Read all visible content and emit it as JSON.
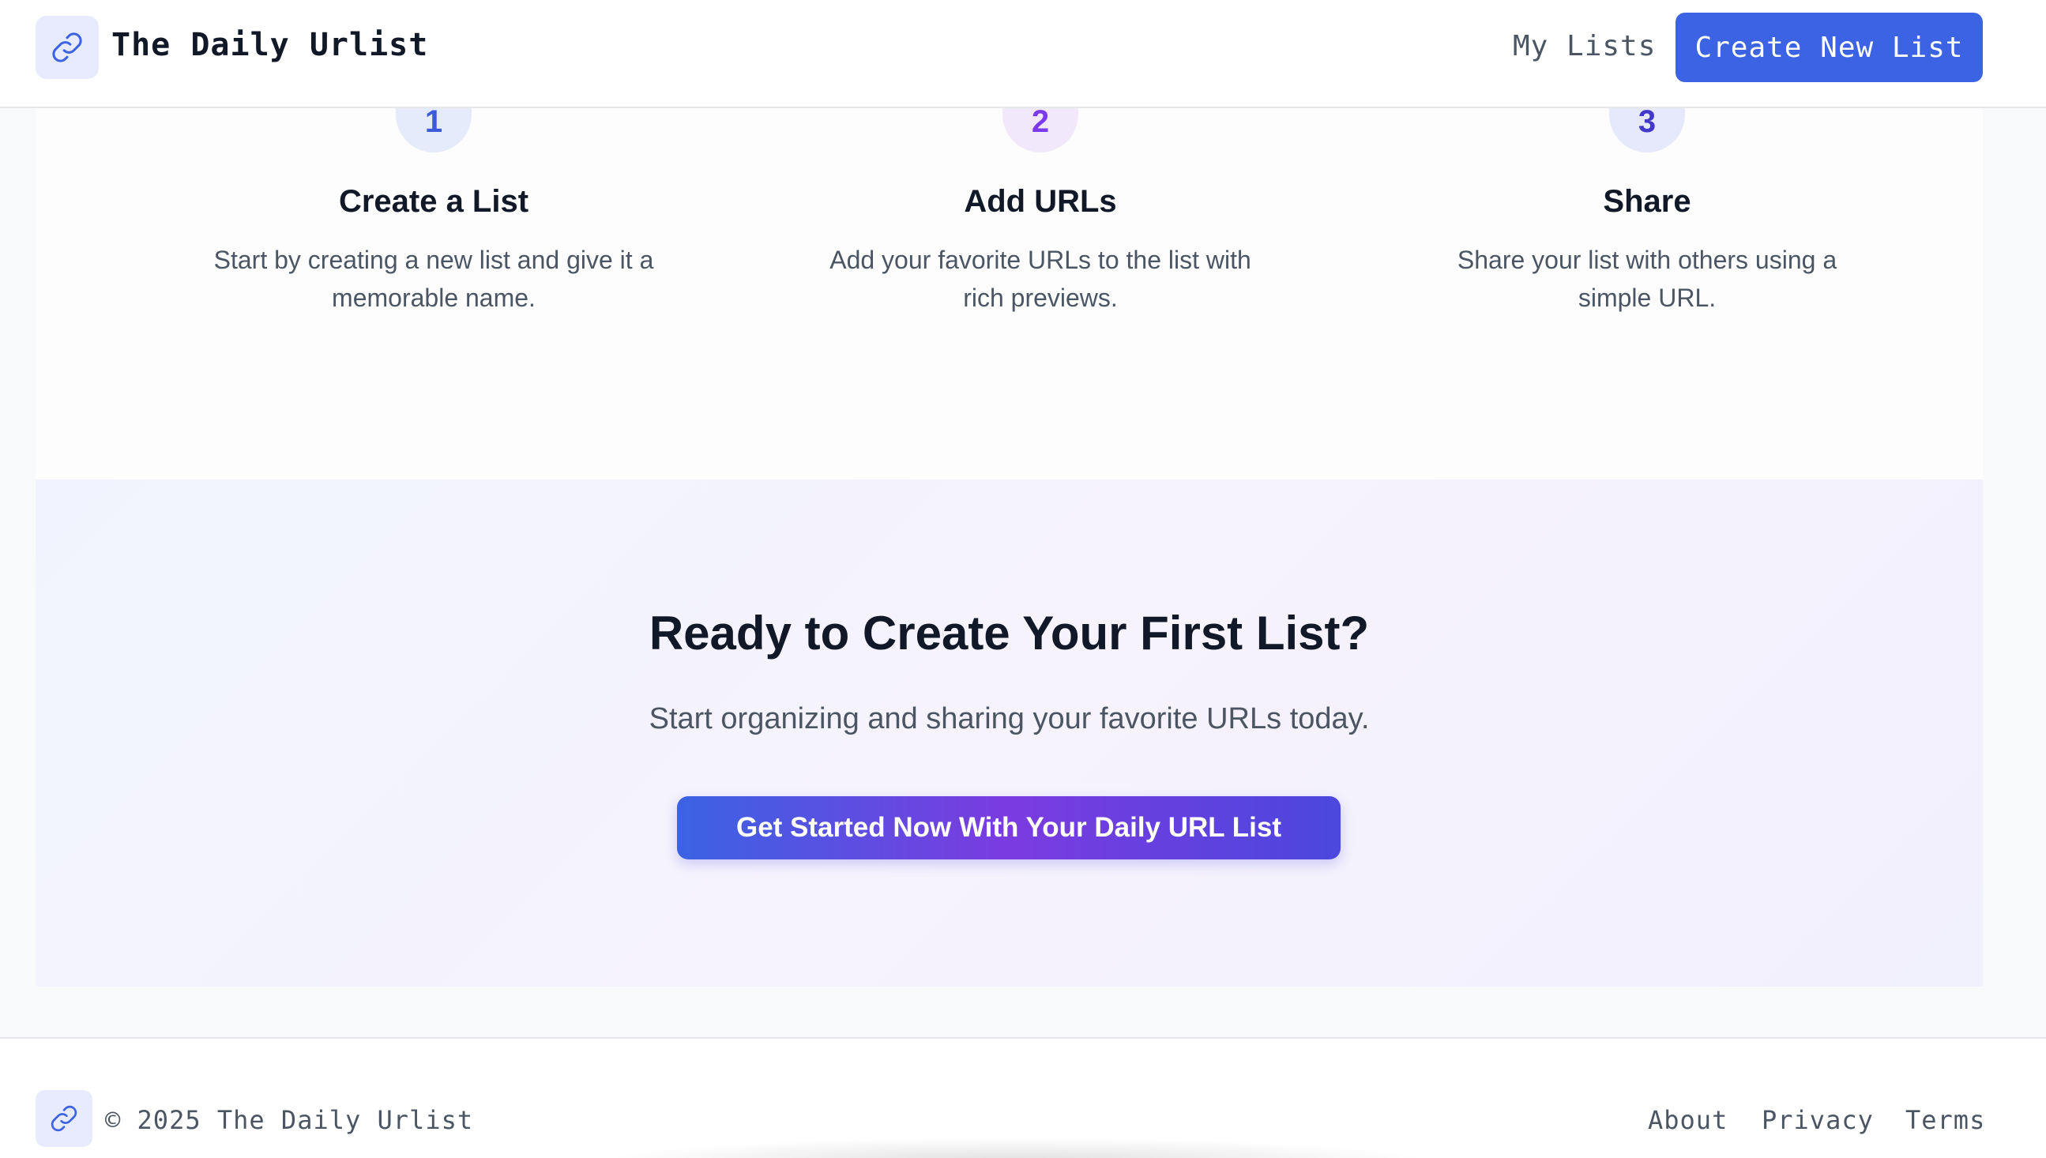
{
  "header": {
    "brand": "The Daily Urlist",
    "logo_icon": "link-icon",
    "nav_my_lists": "My Lists",
    "create_button": "Create New List",
    "accent_color": "#3b63e3"
  },
  "steps": [
    {
      "number": "1",
      "title": "Create a List",
      "description": "Start by creating a new list and give it a memorable name.",
      "color": "#3b5bdb",
      "bg": "#e6ebfb"
    },
    {
      "number": "2",
      "title": "Add URLs",
      "description": "Add your favorite URLs to the list with rich previews.",
      "color": "#7c3aed",
      "bg": "#f1e9fb"
    },
    {
      "number": "3",
      "title": "Share",
      "description": "Share your list with others using a simple URL.",
      "color": "#4338ca",
      "bg": "#e6e8fb"
    }
  ],
  "cta": {
    "title": "Ready to Create Your First List?",
    "subtitle": "Start organizing and sharing your favorite URLs today.",
    "button": "Get Started Now With Your Daily URL List"
  },
  "footer": {
    "logo_icon": "link-icon",
    "copyright": "© 2025 The Daily Urlist",
    "links": [
      "About",
      "Privacy",
      "Terms"
    ]
  }
}
